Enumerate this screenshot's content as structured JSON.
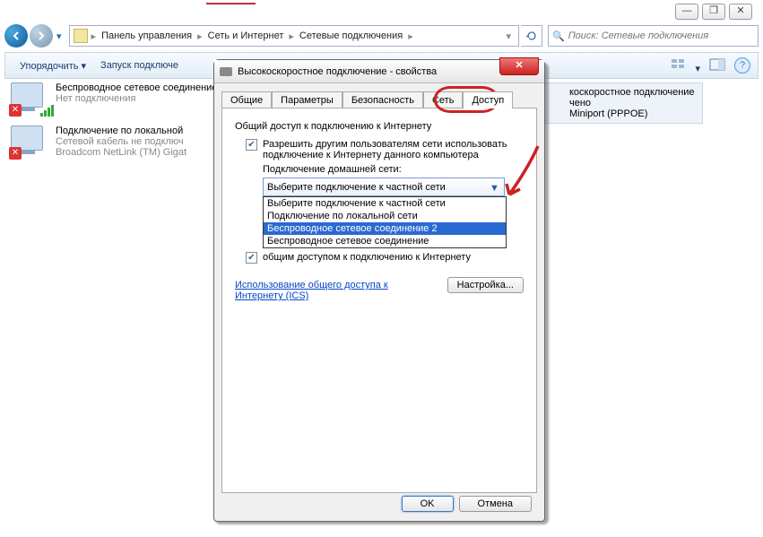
{
  "window": {
    "min": "—",
    "max": "❐",
    "close": "✕"
  },
  "breadcrumb": {
    "root_icon": "folder",
    "items": [
      "Панель управления",
      "Сеть и Интернет",
      "Сетевые подключения"
    ]
  },
  "search": {
    "placeholder": "Поиск: Сетевые подключения"
  },
  "cmdbar": {
    "organize": "Упорядочить ▾",
    "launch": "Запуск подключе"
  },
  "connections": {
    "left": [
      {
        "title": "Беспроводное сетевое соединение",
        "sub1": "Нет подключения",
        "sub2": ""
      },
      {
        "title": "Подключение по локальной",
        "sub1": "Сетевой кабель не подключ",
        "sub2": "Broadcom NetLink (TM) Gigat"
      }
    ],
    "right": {
      "title": "коскоростное подключение",
      "sub1": "чено",
      "sub2": "Miniport (PPPOE)"
    }
  },
  "dialog": {
    "title": "Высокоскоростное подключение - свойства",
    "close_x": "✕",
    "tabs": [
      "Общие",
      "Параметры",
      "Безопасность",
      "Сеть",
      "Доступ"
    ],
    "active_tab": 4,
    "section_heading": "Общий доступ к подключению к Интернету",
    "chk1_label": "Разрешить другим пользователям сети использовать подключение к Интернету данного компьютера",
    "homenet_label": "Подключение домашней сети:",
    "combo_value": "Выберите подключение к частной сети",
    "dropdown": [
      "Выберите подключение к частной сети",
      "Подключение по локальной сети",
      "Беспроводное сетевое соединение 2",
      "Беспроводное сетевое соединение"
    ],
    "dropdown_selected": 2,
    "chk3_tail": "общим доступом к подключению к Интернету",
    "link1": "Использование общего доступа к",
    "link2": "Интернету (ICS)",
    "settings_btn": "Настройка...",
    "ok": "OK",
    "cancel": "Отмена"
  }
}
